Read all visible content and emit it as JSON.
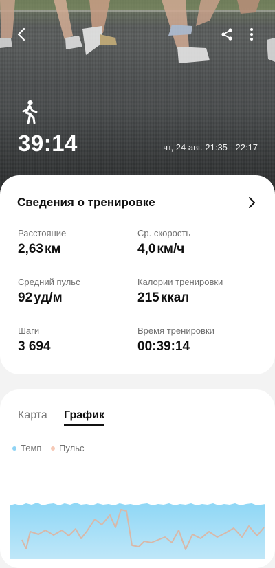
{
  "workout": {
    "duration": "39:14",
    "datetime": "чт, 24 авг. 21:35 - 22:17",
    "activity_icon": "walking-person-icon"
  },
  "toolbar": {
    "back_icon": "back-arrow-icon",
    "share_icon": "share-icon",
    "more_icon": "more-vert-icon"
  },
  "details": {
    "title": "Сведения о тренировке",
    "stats": {
      "distance": {
        "label": "Расстояние",
        "value": "2,63",
        "unit": "км"
      },
      "avg_speed": {
        "label": "Ср. скорость",
        "value": "4,0",
        "unit": "км/ч"
      },
      "avg_pulse": {
        "label": "Средний пульс",
        "value": "92",
        "unit": "уд/м"
      },
      "calories": {
        "label": "Калории тренировки",
        "value": "215",
        "unit": "ккал"
      },
      "steps": {
        "label": "Шаги",
        "value": "3 694",
        "unit": ""
      },
      "workout_time": {
        "label": "Время тренировки",
        "value": "00:39:14",
        "unit": ""
      }
    }
  },
  "graph": {
    "tabs": [
      "Карта",
      "График"
    ],
    "selected_tab": "График",
    "legend": [
      {
        "name": "Темп",
        "color": "#8fd3f4"
      },
      {
        "name": "Пульс",
        "color": "#f6c9b6"
      }
    ]
  }
}
